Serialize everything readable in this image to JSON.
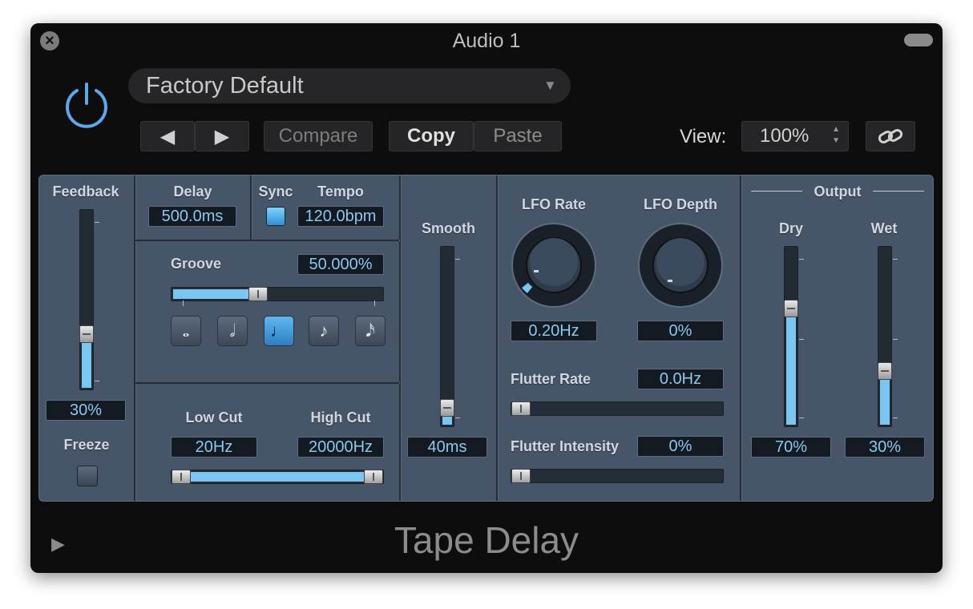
{
  "window": {
    "title": "Audio 1",
    "footer_title": "Tape Delay"
  },
  "header": {
    "preset": "Factory Default",
    "prev_label": "◀",
    "next_label": "▶",
    "compare_label": "Compare",
    "copy_label": "Copy",
    "paste_label": "Paste",
    "view_label": "View:",
    "view_value": "100%"
  },
  "params": {
    "feedback": {
      "label": "Feedback",
      "value": "30%",
      "level": 0.3
    },
    "freeze": {
      "label": "Freeze",
      "on": false
    },
    "delay": {
      "label": "Delay",
      "value": "500.0ms"
    },
    "sync": {
      "label": "Sync",
      "on": true
    },
    "tempo": {
      "label": "Tempo",
      "value": "120.0bpm"
    },
    "groove": {
      "label": "Groove",
      "value": "50.000%",
      "level": 0.5
    },
    "note_values": [
      "𝅝",
      "𝅗𝅥",
      "♩",
      "♪",
      "𝅘𝅥𝅯"
    ],
    "note_selected": 2,
    "low_cut": {
      "label": "Low Cut",
      "value": "20Hz"
    },
    "high_cut": {
      "label": "High Cut",
      "value": "20000Hz"
    },
    "smooth": {
      "label": "Smooth",
      "value": "40ms",
      "level": 0.08
    },
    "lfo_rate": {
      "label": "LFO Rate",
      "value": "0.20Hz"
    },
    "lfo_depth": {
      "label": "LFO Depth",
      "value": "0%"
    },
    "flutter_rate": {
      "label": "Flutter Rate",
      "value": "0.0Hz"
    },
    "flutter_intensity": {
      "label": "Flutter Intensity",
      "value": "0%"
    },
    "output": {
      "label": "Output"
    },
    "dry": {
      "label": "Dry",
      "value": "70%",
      "level": 0.7
    },
    "wet": {
      "label": "Wet",
      "value": "30%",
      "level": 0.3
    }
  },
  "colors": {
    "accent": "#79c6f2",
    "panel": "#465568",
    "window": "#0d0d0e"
  }
}
